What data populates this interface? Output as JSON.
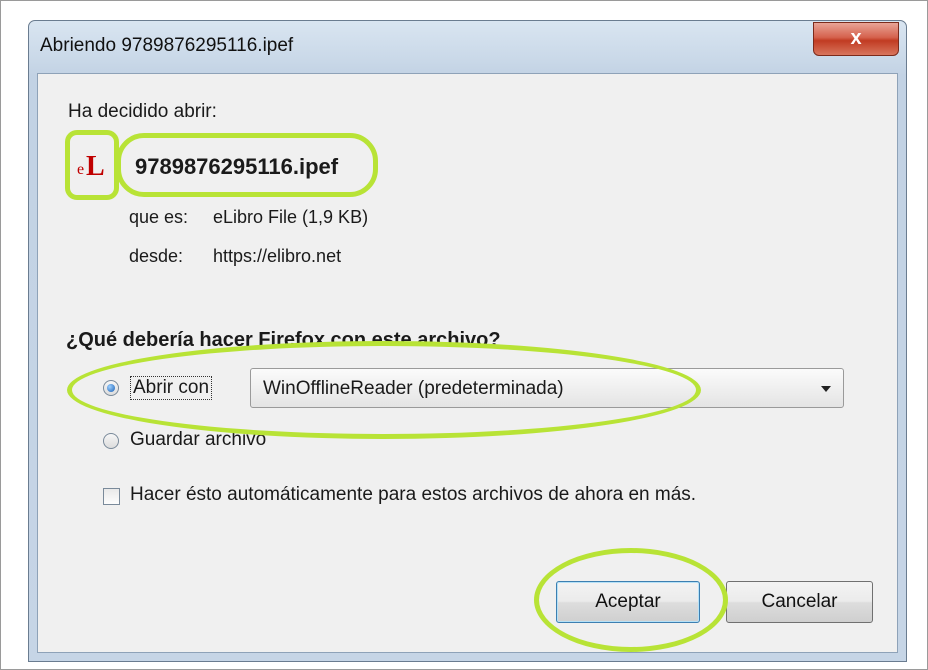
{
  "window": {
    "title": "Abriendo 9789876295116.ipef",
    "close_symbol": "x"
  },
  "intro": "Ha decidido abrir:",
  "file": {
    "icon_name": "elibro-icon",
    "icon_e": "e",
    "icon_L": "L",
    "name": "9789876295116.ipef",
    "type_label": "que es:",
    "type_value": "eLibro File (1,9 KB)",
    "from_label": "desde:",
    "from_value": "https://elibro.net"
  },
  "question": "¿Qué debería hacer Firefox con este archivo?",
  "options": {
    "open_label": "Abrir con",
    "open_selected": true,
    "app_select_value": "WinOfflineReader (predeterminada)",
    "save_label": "Guardar archivo",
    "save_selected": false
  },
  "auto_checkbox": {
    "label": "Hacer ésto automáticamente para estos archivos de ahora en más.",
    "checked": false
  },
  "buttons": {
    "ok": "Aceptar",
    "cancel": "Cancelar"
  },
  "highlight_color": "#b8e336"
}
